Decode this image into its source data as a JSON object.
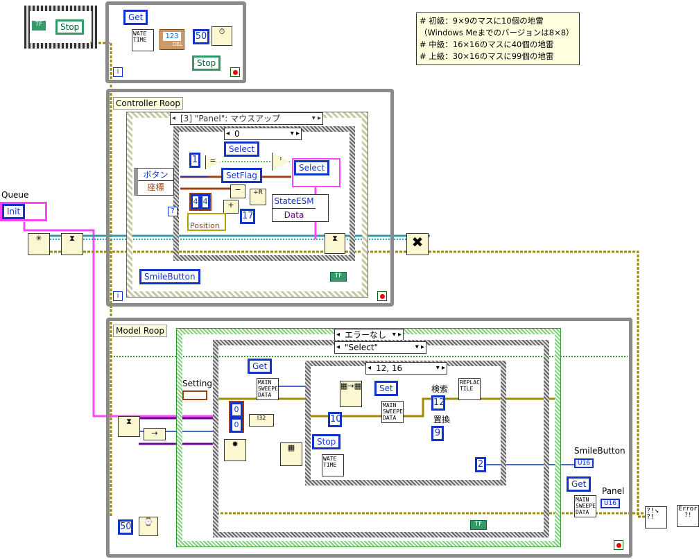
{
  "comment": [
    "# 初級：9×9のマスに10個の地雷",
    "（Windows Meまでのバージョンは8×8）",
    "# 中級：16×16のマスに40個の地雷",
    "# 上級：30×16のマスに99個の地雷"
  ],
  "top_loop": {
    "stop_label": "Stop",
    "tf": "TF",
    "get": "Get",
    "wait": "WATE TIME",
    "indicator": "123",
    "dbl": "DBL",
    "const_50": "50",
    "stop_button": "Stop",
    "iter": "i"
  },
  "queue": {
    "label": "Queue",
    "init": "Init"
  },
  "controller": {
    "label": "Controller Roop",
    "event_selector": "[3] \"Panel\": マウスアップ",
    "case_selector": "0",
    "select1": "Select",
    "setflag": "SetFlag",
    "select2": "Select",
    "const_1": "1",
    "btn": "ボタン",
    "coord": "座標",
    "arr": [
      "4",
      "4"
    ],
    "const_17": "17",
    "position": "Position",
    "state": "StateESM",
    "data": "Data",
    "smile": "SmileButton",
    "tf": "TF",
    "iter": "i",
    "qmark": "?"
  },
  "model": {
    "label": "Model Roop",
    "case_err": "エラーなし",
    "case_sel": "\"Select\"",
    "case_inner": "12, 16",
    "get": "Get",
    "setting": "Setting",
    "arr": [
      "0",
      "0"
    ],
    "main_data": "MAIN SWEEPE DATA",
    "set": "Set",
    "const_10": "10",
    "stop": "Stop",
    "wait": "WATE TIME",
    "search": "検索",
    "const_12": "12",
    "replace": "置換",
    "const_9": "9",
    "replace_tile": "REPLAC TILE",
    "const_2": "2",
    "smile": "SmileButton",
    "u16": "U16",
    "get2": "Get",
    "panel": "Panel",
    "const_50": "50",
    "tf": "TF",
    "i32": "I32"
  },
  "colors": {
    "enum": "#1133cc",
    "error": "#b8a000",
    "loop": "#8a8a8a",
    "queue": "#ff33ff"
  }
}
